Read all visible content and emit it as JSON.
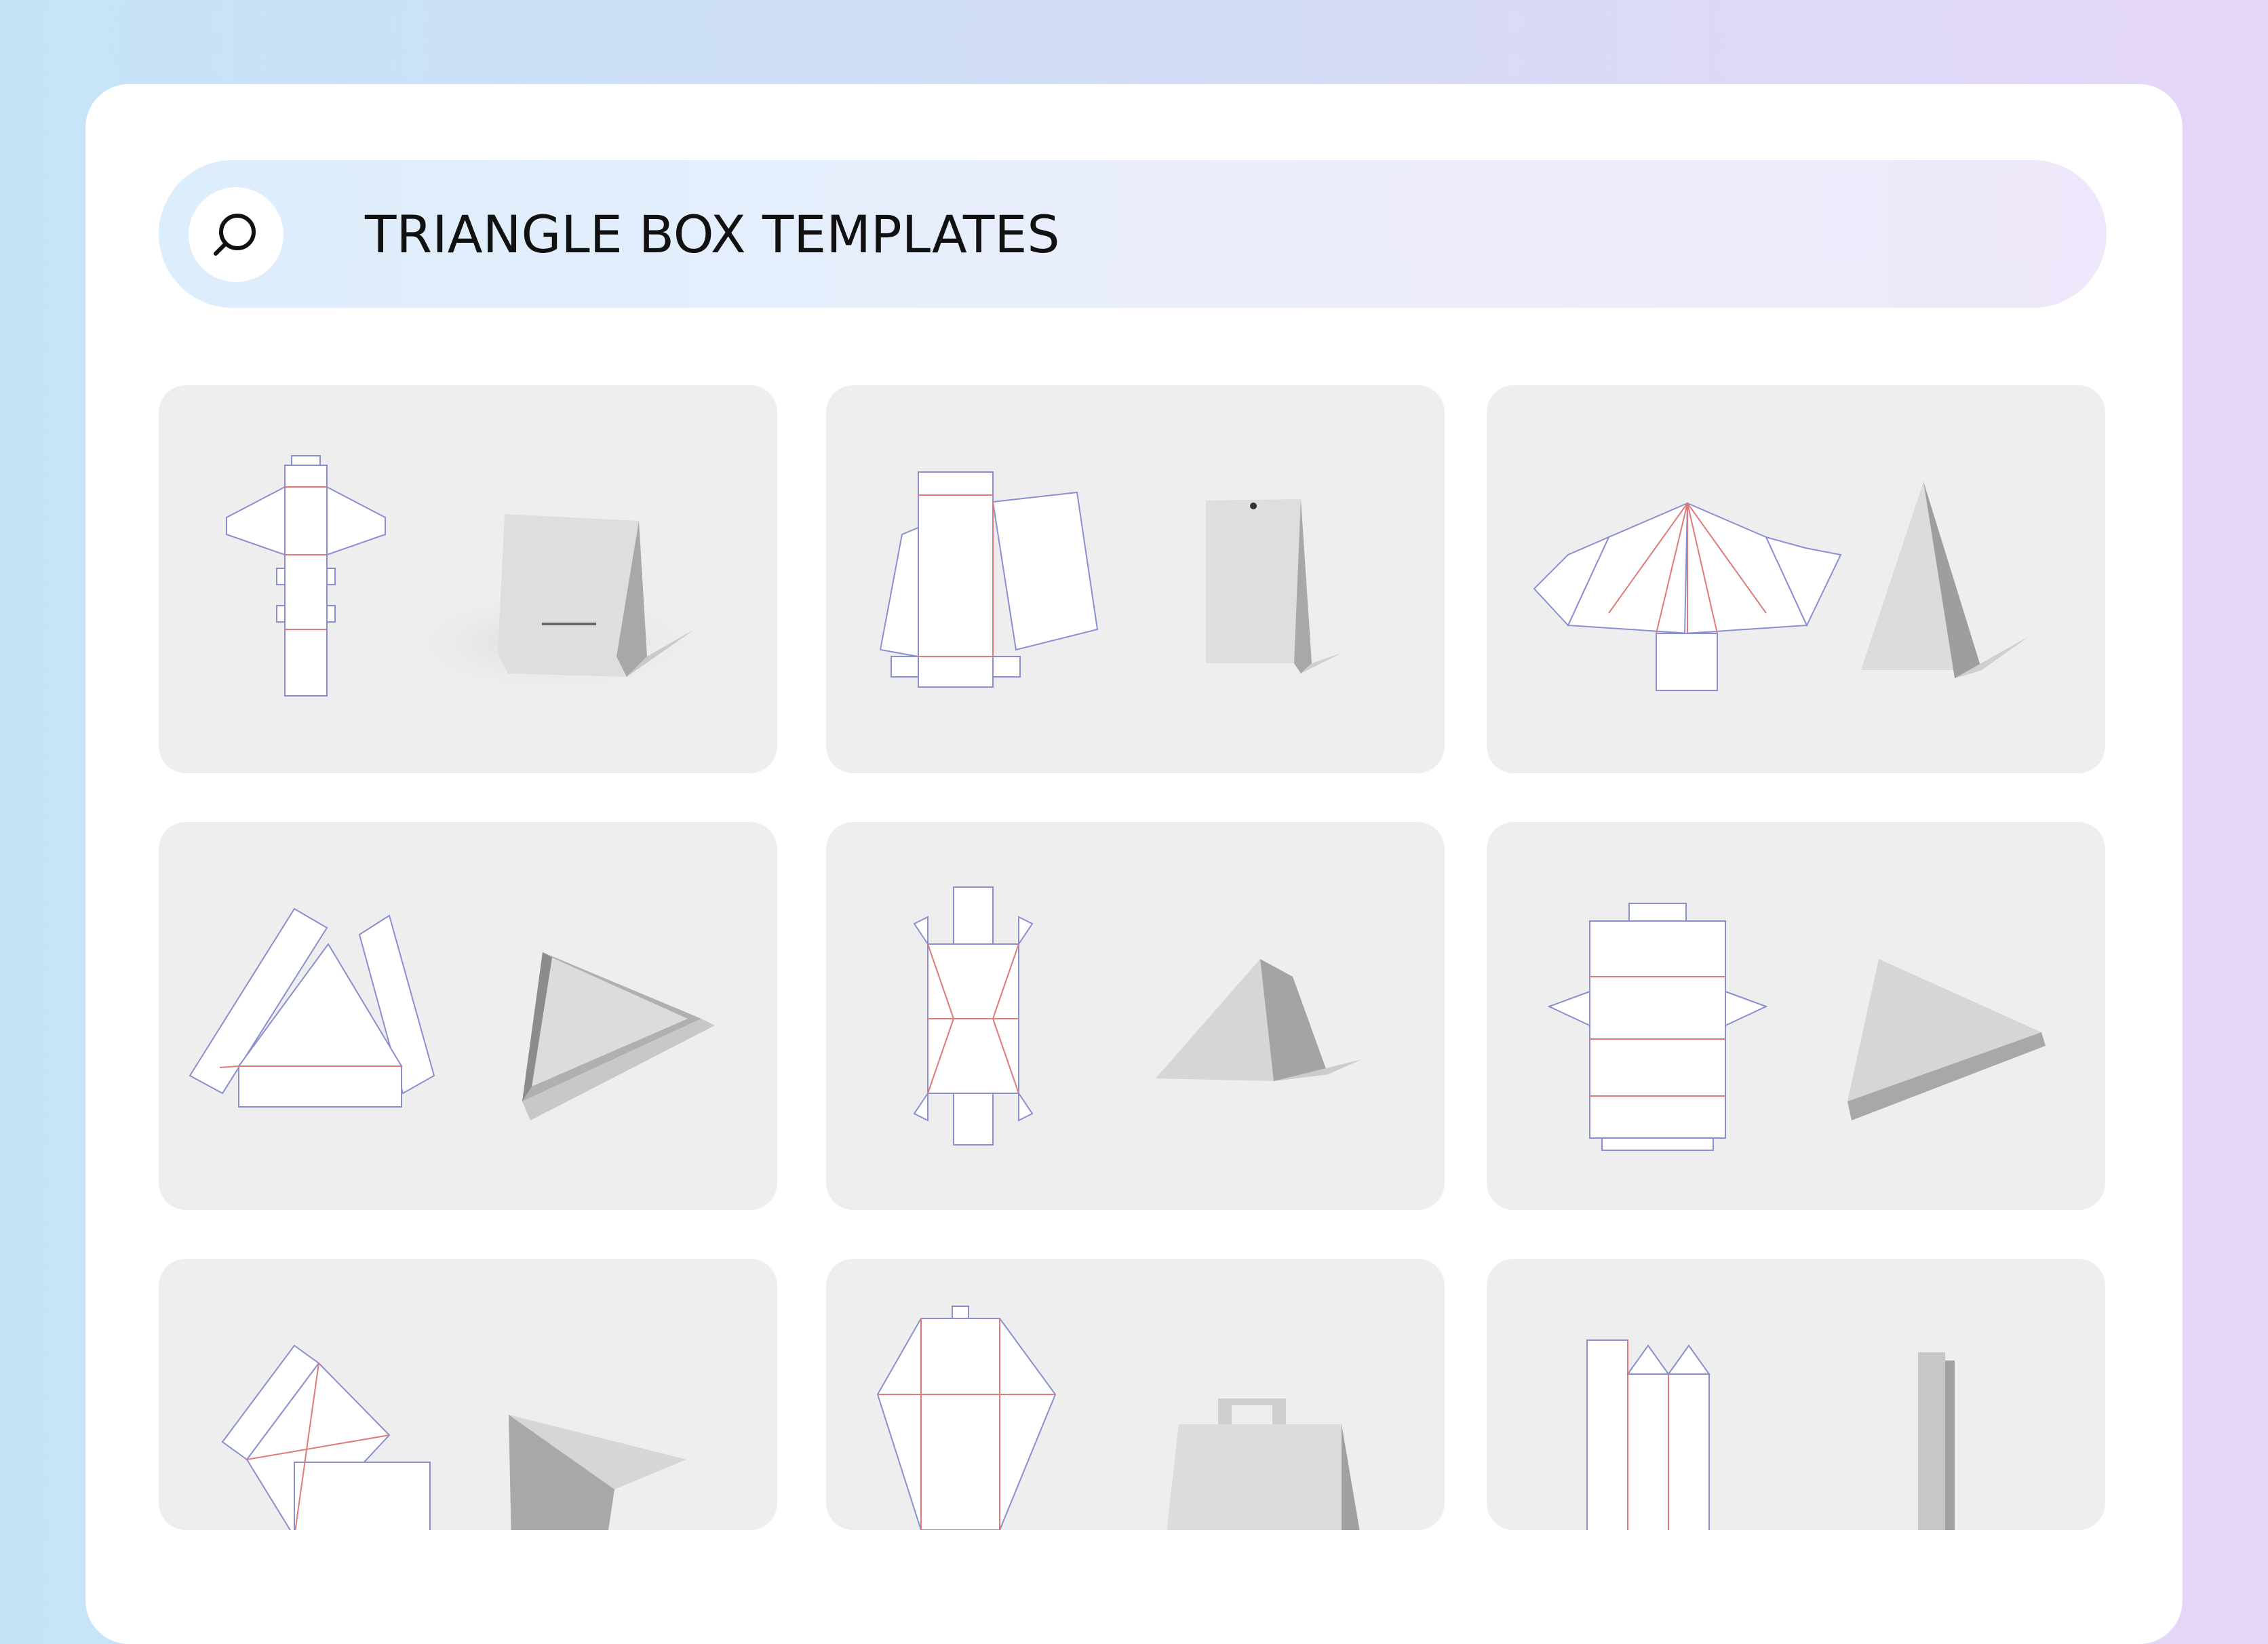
{
  "search": {
    "title": "TRIANGLE BOX TEMPLATES",
    "icon": "search-icon"
  },
  "gallery": {
    "items": [
      {
        "id": "1",
        "icon": "triangle-box-template-thumbnail"
      },
      {
        "id": "2",
        "icon": "triangle-box-template-thumbnail"
      },
      {
        "id": "3",
        "icon": "triangle-box-template-thumbnail"
      },
      {
        "id": "4",
        "icon": "triangle-box-template-thumbnail"
      },
      {
        "id": "5",
        "icon": "triangle-box-template-thumbnail"
      },
      {
        "id": "6",
        "icon": "triangle-box-template-thumbnail"
      },
      {
        "id": "7",
        "icon": "triangle-box-template-thumbnail"
      },
      {
        "id": "8",
        "icon": "triangle-box-template-thumbnail"
      },
      {
        "id": "9",
        "icon": "triangle-box-template-thumbnail"
      }
    ]
  },
  "colors": {
    "card_bg": "#eeeeee",
    "cut_line": "#8a8fd0",
    "fold_line": "#e07a7a",
    "box_light": "#dcdcdc",
    "box_dark": "#9e9e9e"
  }
}
